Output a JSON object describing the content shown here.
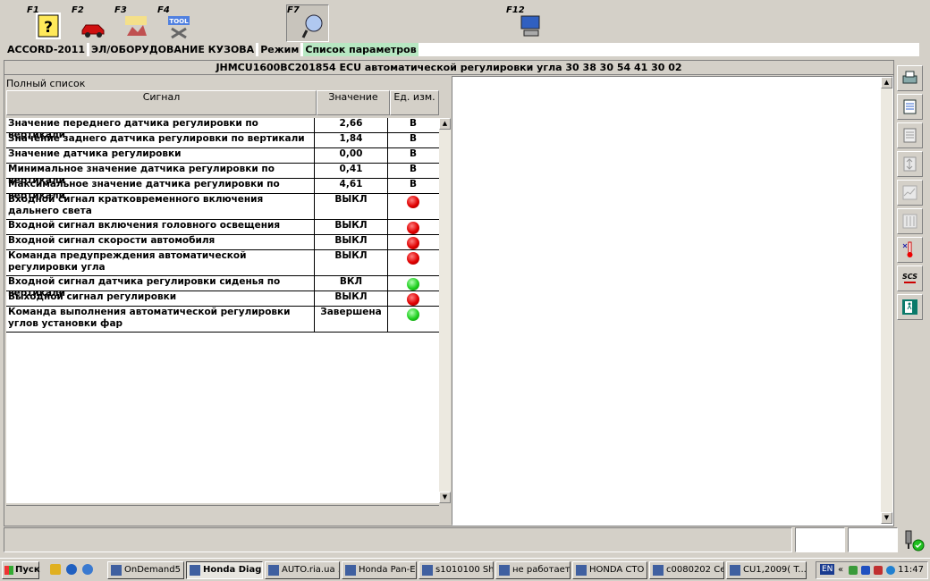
{
  "toolbar": {
    "keys": [
      {
        "label": "F1",
        "icon": "help-icon"
      },
      {
        "label": "F2",
        "icon": "car-icon"
      },
      {
        "label": "F3",
        "icon": "body-work-icon"
      },
      {
        "label": "F4",
        "icon": "tool-icon"
      },
      {
        "label": "F7",
        "icon": "scan-icon"
      },
      {
        "label": "F12",
        "icon": "computer-icon"
      }
    ]
  },
  "breadcrumb": {
    "model": "ACCORD-2011",
    "system": "ЭЛ/ОБОРУДОВАНИЕ КУЗОВА",
    "mode_label": "Режим",
    "mode_value": "Список параметров"
  },
  "ecu": {
    "title": "JHMCU1600BC201854  ECU автоматической регулировки угла  30 38 30 54 41 30 02"
  },
  "list": {
    "title": "Полный список",
    "columns": {
      "signal": "Сигнал",
      "value": "Значение",
      "unit": "Ед. изм."
    },
    "rows": [
      {
        "name": "Значение переднего датчика регулировки по вертикали",
        "value": "2,66",
        "unit": "В"
      },
      {
        "name": "Значение заднего датчика регулировки по вертикали",
        "value": "1,84",
        "unit": "В"
      },
      {
        "name": "Значение датчика регулировки",
        "value": "0,00",
        "unit": "В"
      },
      {
        "name": "Минимальное значение датчика регулировки по вертикали",
        "value": "0,41",
        "unit": "В"
      },
      {
        "name": "Максимальное значение датчика регулировки по вертикали",
        "value": "4,61",
        "unit": "В"
      },
      {
        "name": "Входной сигнал кратковременного включения дальнего света",
        "value": "ВЫКЛ",
        "lamp": "red"
      },
      {
        "name": "Входной сигнал включения головного освещения",
        "value": "ВЫКЛ",
        "lamp": "red"
      },
      {
        "name": "Входной сигнал скорости автомобиля",
        "value": "ВЫКЛ",
        "lamp": "red"
      },
      {
        "name": "Команда предупреждения автоматической регулировки угла",
        "value": "ВЫКЛ",
        "lamp": "red"
      },
      {
        "name": "Входной сигнал датчика регулировки сиденья по вертикали",
        "value": "ВКЛ",
        "lamp": "green"
      },
      {
        "name": "Выходной сигнал регулировки",
        "value": "ВЫКЛ",
        "lamp": "red"
      },
      {
        "name": "Команда выполнения автоматической регулировки углов установки фар",
        "value": "Завершена",
        "lamp": "green"
      }
    ]
  },
  "colors": {
    "lamp_red": "#e00000",
    "lamp_green": "#20d020",
    "mode_highlight": "#b7e7c2"
  },
  "right_tools": [
    "printer-icon",
    "settings-list-icon",
    "document-icon",
    "updown-icon",
    "graph-icon",
    "columns-icon",
    "thermometer-icon",
    "scs-icon",
    "exit-icon"
  ],
  "scs_label": "SCS",
  "taskbar": {
    "start": "Пуск",
    "items": [
      "OnDemand5",
      "Honda Diag...",
      "AUTO.ria.ua ...",
      "Honda Pan-E...",
      "s1010100 Sh...",
      "не работает...",
      "HONDA СТО ...",
      "c0080202 Ce...",
      "CU1,2009( T..."
    ],
    "active_index": 1,
    "lang": "EN",
    "clock": "11:47"
  }
}
